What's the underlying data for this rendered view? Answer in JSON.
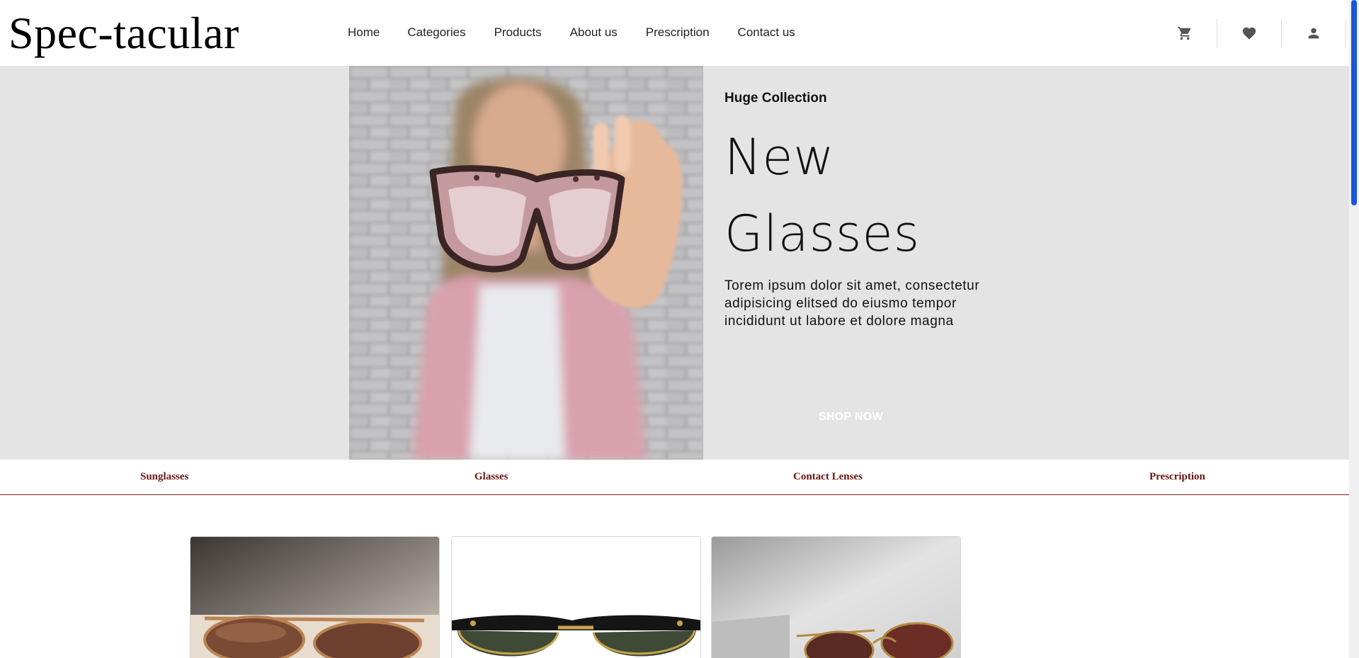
{
  "header": {
    "brand": "Spec-tacular",
    "nav": [
      {
        "label": "Home"
      },
      {
        "label": "Categories"
      },
      {
        "label": "Products"
      },
      {
        "label": "About us"
      },
      {
        "label": "Prescription"
      },
      {
        "label": "Contact us"
      }
    ],
    "icons": [
      "cart-icon",
      "heart-icon",
      "user-icon"
    ]
  },
  "hero": {
    "kicker": "Huge Collection",
    "headline_line1": "New",
    "headline_line2": "Glasses",
    "blurb": "Torem ipsum dolor sit amet, consectetur adipisicing elitsed do eiusmo tempor incididunt ut labore et dolore magna",
    "cta": "SHOP NOW"
  },
  "categories": [
    {
      "label": "Sunglasses"
    },
    {
      "label": "Glasses"
    },
    {
      "label": "Contact Lenses"
    },
    {
      "label": "Prescription"
    }
  ],
  "colors": {
    "hero_bg": "#e4e4e4",
    "category_text": "#6a1414",
    "scroll_thumb": "#1a56d6"
  }
}
